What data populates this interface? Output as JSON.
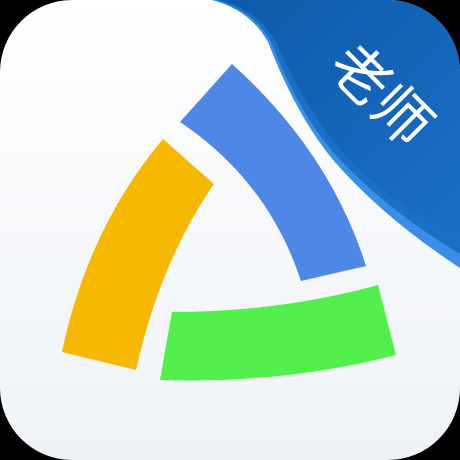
{
  "app_icon": {
    "badge_text": "老师",
    "colors": {
      "background": "#000000",
      "tile_top": "#ffffff",
      "tile_bottom": "#eef2f7",
      "ribbon_dark": "#0d5aa8",
      "ribbon_mid": "#1a6fc7",
      "ribbon_light": "#3b8ee6",
      "segment_blue": "#4f87e6",
      "segment_yellow": "#f6b800",
      "segment_green": "#52ef4d",
      "badge_text": "#ffffff"
    },
    "icons": [
      "triangle-logo-icon",
      "corner-ribbon"
    ]
  }
}
